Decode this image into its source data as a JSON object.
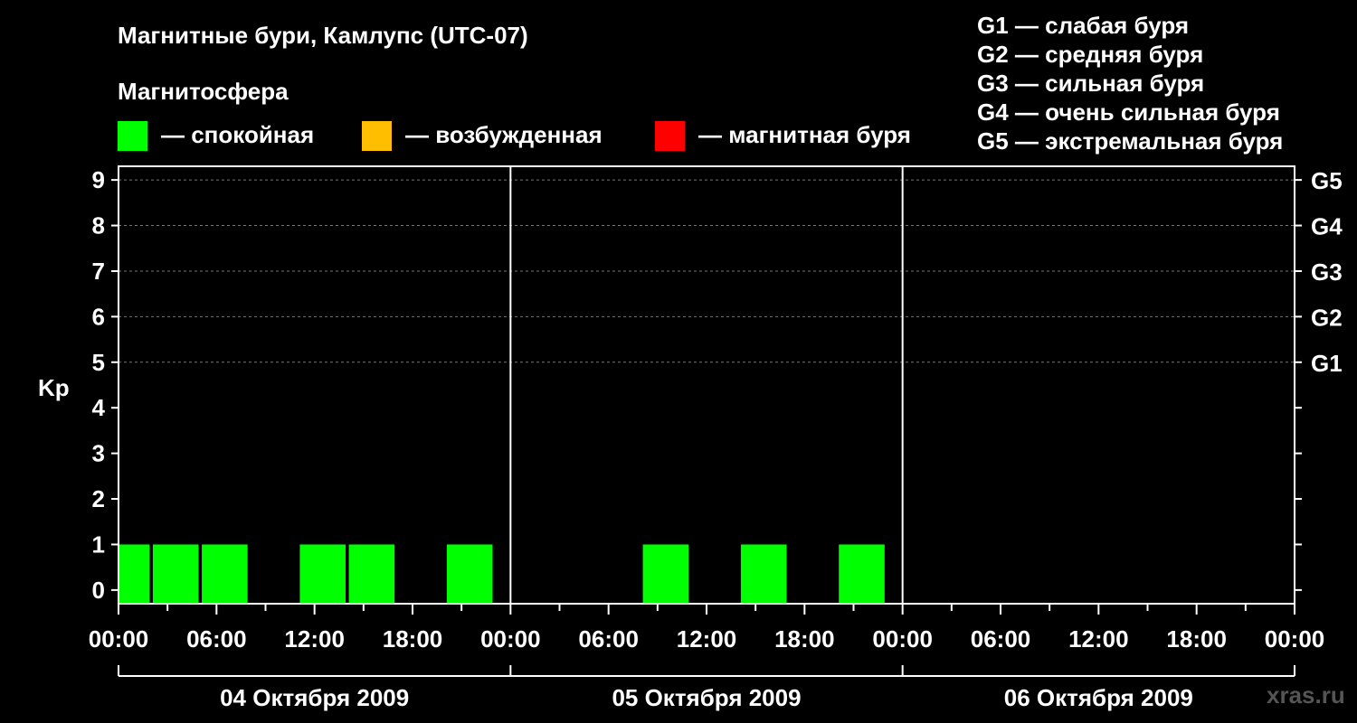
{
  "chart_data": {
    "type": "bar",
    "title": "Магнитные бури, Камлупс (UTC-07)",
    "legend": {
      "heading": "Магнитосфера",
      "items": [
        {
          "label": "— спокойная",
          "color": "#00ff00"
        },
        {
          "label": "— возбужденная",
          "color": "#ffbf00"
        },
        {
          "label": "— магнитная буря",
          "color": "#ff0000"
        }
      ]
    },
    "storm_scale": [
      "G1 — слабая буря",
      "G2 — средняя буря",
      "G3 — сильная буря",
      "G4 — очень сильная буря",
      "G5 — экстремальная буря"
    ],
    "ylabel": "Kp",
    "ylim": [
      -0.3,
      9.3
    ],
    "y_ticks": [
      "0",
      "1",
      "2",
      "3",
      "4",
      "5",
      "6",
      "7",
      "8",
      "9"
    ],
    "right_ticks": [
      {
        "value": 5,
        "label": "G1"
      },
      {
        "value": 6,
        "label": "G2"
      },
      {
        "value": 7,
        "label": "G3"
      },
      {
        "value": 8,
        "label": "G4"
      },
      {
        "value": 9,
        "label": "G5"
      }
    ],
    "grid_levels": [
      5,
      6,
      7,
      8,
      9
    ],
    "x_range_hours": [
      0,
      72
    ],
    "x_tick_labels": [
      "00:00",
      "06:00",
      "12:00",
      "18:00",
      "00:00",
      "06:00",
      "12:00",
      "18:00",
      "00:00",
      "06:00",
      "12:00",
      "18:00",
      "00:00"
    ],
    "day_labels": [
      "04 Октября 2009",
      "05 Октября 2009",
      "06 Октября 2009"
    ],
    "bars": [
      {
        "start_hour": 0,
        "end_hour": 1.9,
        "kp": 1,
        "color": "#00ff00"
      },
      {
        "start_hour": 2.1,
        "end_hour": 4.9,
        "kp": 1,
        "color": "#00ff00"
      },
      {
        "start_hour": 5.1,
        "end_hour": 7.9,
        "kp": 1,
        "color": "#00ff00"
      },
      {
        "start_hour": 11.1,
        "end_hour": 13.9,
        "kp": 1,
        "color": "#00ff00"
      },
      {
        "start_hour": 14.1,
        "end_hour": 16.9,
        "kp": 1,
        "color": "#00ff00"
      },
      {
        "start_hour": 20.1,
        "end_hour": 22.9,
        "kp": 1,
        "color": "#00ff00"
      },
      {
        "start_hour": 32.1,
        "end_hour": 34.9,
        "kp": 1,
        "color": "#00ff00"
      },
      {
        "start_hour": 38.1,
        "end_hour": 40.9,
        "kp": 1,
        "color": "#00ff00"
      },
      {
        "start_hour": 44.1,
        "end_hour": 46.9,
        "kp": 1,
        "color": "#00ff00"
      }
    ]
  },
  "watermark": "xras.ru"
}
